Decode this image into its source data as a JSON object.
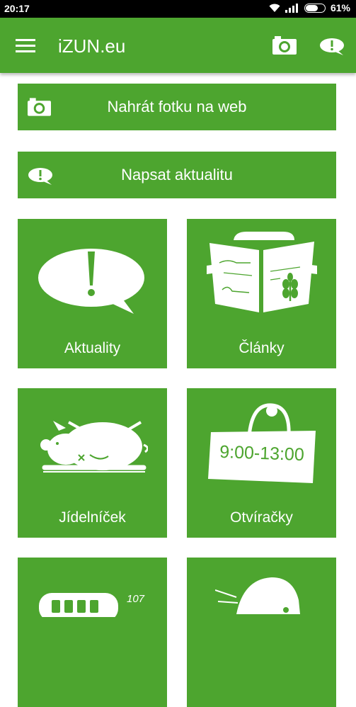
{
  "status_bar": {
    "time": "20:17",
    "battery": "61%",
    "icons": [
      "wifi-icon",
      "signal-icon",
      "battery-icon"
    ]
  },
  "app_bar": {
    "title": "iZUN.eu",
    "icons": [
      "menu-icon",
      "camera-icon",
      "news-bubble-icon"
    ]
  },
  "actions": {
    "upload_photo": "Nahrát fotku na web",
    "write_news": "Napsat aktualitu"
  },
  "tiles": [
    {
      "label": "Aktuality",
      "icon": "speech-bubble-exclamation-icon"
    },
    {
      "label": "Články",
      "icon": "newspaper-icon"
    },
    {
      "label": "Jídelníček",
      "icon": "roast-pig-icon"
    },
    {
      "label": "Otvíračky",
      "icon": "opening-hours-sign-icon",
      "sign_text": "9:00-13:00"
    },
    {
      "label": "",
      "icon": "bus-icon",
      "bus_number": "107"
    },
    {
      "label": "",
      "icon": "animal-icon"
    }
  ],
  "colors": {
    "primary": "#4da52f",
    "status_bar": "#000000",
    "background": "#ffffff"
  }
}
